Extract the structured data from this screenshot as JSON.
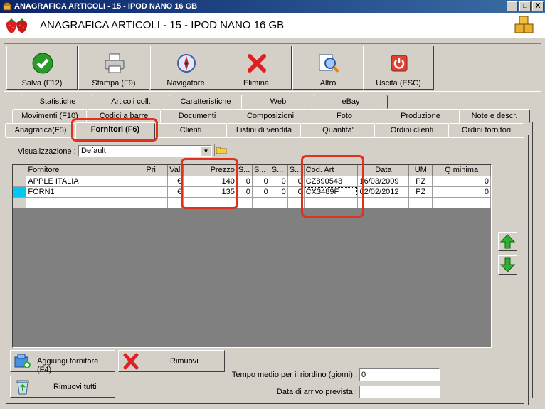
{
  "window": {
    "title": "ANAGRAFICA ARTICOLI - 15 - IPOD NANO 16 GB",
    "header_title": "ANAGRAFICA ARTICOLI - 15 - IPOD NANO 16 GB",
    "controls": [
      "_",
      "□",
      "X"
    ]
  },
  "toolbar": {
    "buttons": [
      {
        "label": "Salva (F12)",
        "icon": "check-icon"
      },
      {
        "label": "Stampa (F9)",
        "icon": "printer-icon"
      },
      {
        "label": "Navigatore",
        "icon": "compass-icon"
      },
      {
        "label": "Elimina",
        "icon": "delete-x-icon"
      },
      {
        "label": "Altro",
        "icon": "magnifier-icon"
      },
      {
        "label": "Uscita (ESC)",
        "icon": "power-icon"
      }
    ]
  },
  "tabs": {
    "row1": [
      "Statistiche",
      "Articoli coll.",
      "Caratteristiche",
      "Web",
      "eBay"
    ],
    "row2": [
      "Movimenti (F10)",
      "Codici a barre",
      "Documenti",
      "Composizioni",
      "Foto",
      "Produzione",
      "Note e descr."
    ],
    "row3": [
      "Anagrafica(F5)",
      "Fornitori (F6)",
      "Clienti",
      "Listini di vendita",
      "Quantita'",
      "Ordini clienti",
      "Ordini fornitori"
    ]
  },
  "view": {
    "label": "Visualizzazione :",
    "selected": "Default"
  },
  "grid": {
    "columns": [
      "Fornitore",
      "Pri",
      "Val",
      "Prezzo",
      "S...",
      "S...",
      "S...",
      "S...",
      "Cod. Art",
      "Data",
      "UM",
      "Q minima"
    ],
    "rows": [
      [
        "APPLE ITALIA",
        "",
        "€",
        "140",
        "0",
        "0",
        "0",
        "0",
        "CZ890543",
        "16/03/2009",
        "PZ",
        "0"
      ],
      [
        "FORN1",
        "",
        "€",
        "135",
        "0",
        "0",
        "0",
        "0",
        "CX3489F",
        "02/02/2012",
        "PZ",
        "0"
      ]
    ]
  },
  "actions": {
    "add": "Aggiungi fornitore (F4)",
    "remove": "Rimuovi",
    "remove_all": "Rimuovi tutti"
  },
  "fields": {
    "tempo_label": "Tempo medio per il riordino (giorni) :",
    "tempo_value": "0",
    "data_label": "Data di arrivo prevista :",
    "data_value": ""
  },
  "colors": {
    "highlight": "#e0301e",
    "current_row_indicator": "#00c8f0"
  }
}
